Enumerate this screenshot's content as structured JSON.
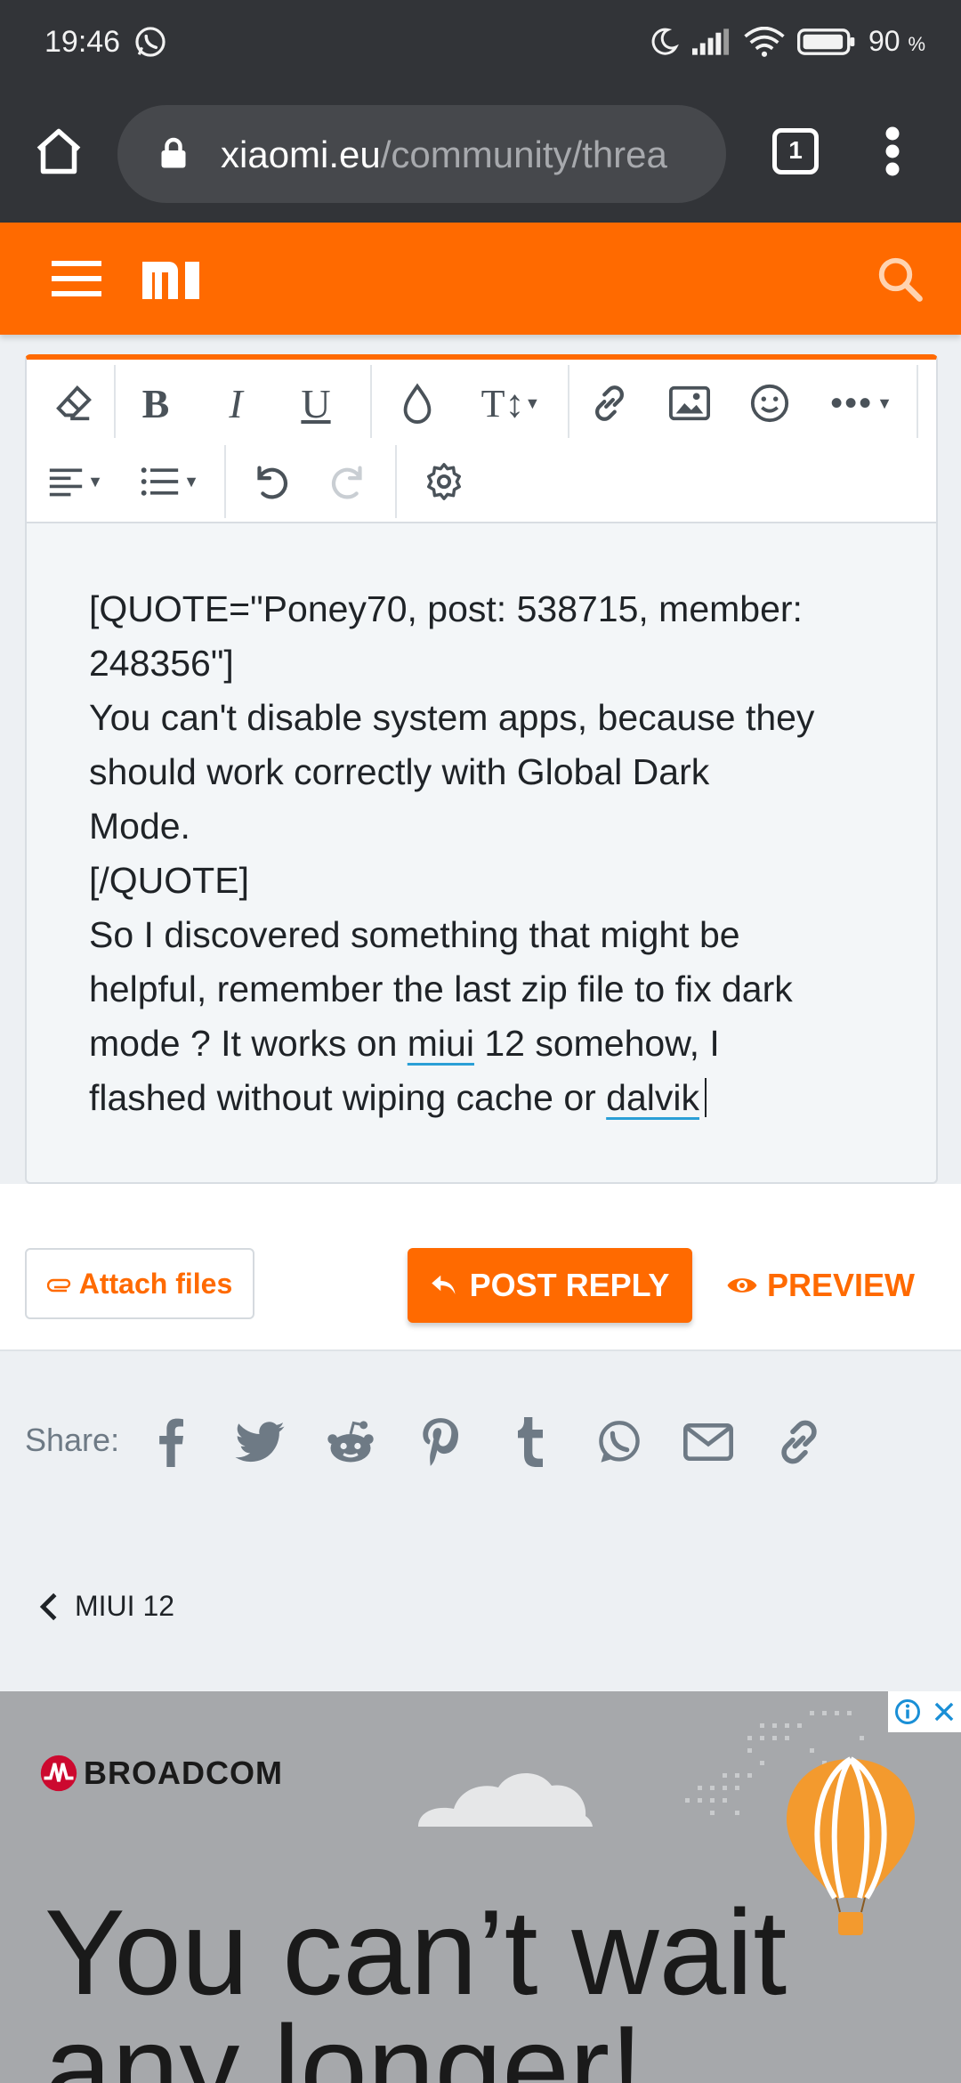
{
  "status_bar": {
    "time": "19:46",
    "battery": "90",
    "battery_unit": "%"
  },
  "browser": {
    "url_domain": "xiaomi.eu",
    "url_path": "/community/threa",
    "tab_count": "1"
  },
  "site": {
    "logo": "mi"
  },
  "editor": {
    "lines": [
      "[QUOTE=\"Poney70, post: 538715, member:",
      "248356\"]",
      "You can't disable system apps, because they",
      "should work correctly with Global Dark",
      "Mode.",
      "[/QUOTE]",
      "So I discovered something that might be",
      "helpful, remember the last zip file to fix dark"
    ],
    "line9_pre": "mode ? It works on ",
    "line9_link": "miui",
    "line9_post": " 12 somehow, I",
    "line10_pre": "flashed without wiping cache or ",
    "line10_link": "dalvik"
  },
  "actions": {
    "attach": "Attach files",
    "post": "POST REPLY",
    "preview": "PREVIEW"
  },
  "share": {
    "label": "Share:",
    "icons": [
      "facebook-icon",
      "twitter-icon",
      "reddit-icon",
      "pinterest-icon",
      "tumblr-icon",
      "whatsapp-icon",
      "email-icon",
      "link-icon"
    ]
  },
  "breadcrumb": {
    "label": "MIUI 12"
  },
  "ad": {
    "brand": "BROADCOM",
    "headline_1": "You can’t wait",
    "headline_2": "any longer!"
  },
  "colors": {
    "accent": "#ff6a00",
    "browser_bg": "#323438",
    "link_underline": "#2a9fd6",
    "icon_gray": "#6e7a85"
  }
}
